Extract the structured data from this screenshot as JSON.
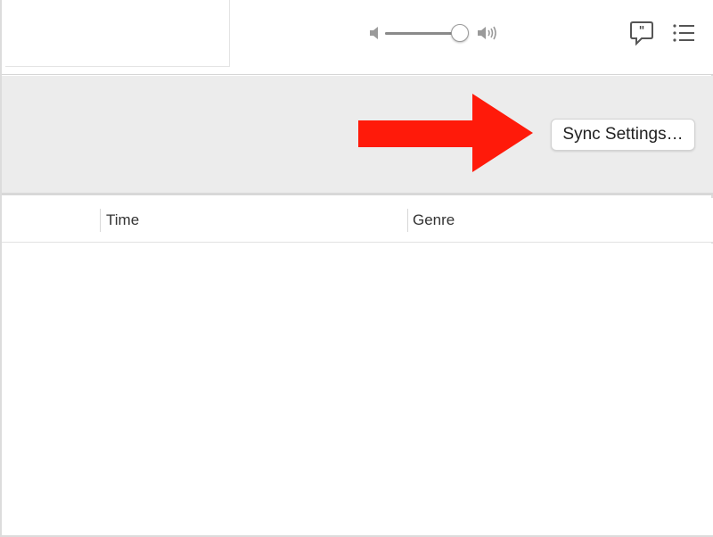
{
  "toolbar": {
    "volume_level": 0.85,
    "icons": [
      "speaker-low-icon",
      "speaker-high-icon",
      "lyrics-quote-icon",
      "up-next-list-icon"
    ]
  },
  "header": {
    "sync_button_label": "Sync Settings…",
    "annotation_arrow_color": "#ff1a0a"
  },
  "columns": [
    {
      "label": "Time"
    },
    {
      "label": "Genre"
    }
  ],
  "colors": {
    "band": "#ececec",
    "background": "#ffffff"
  }
}
